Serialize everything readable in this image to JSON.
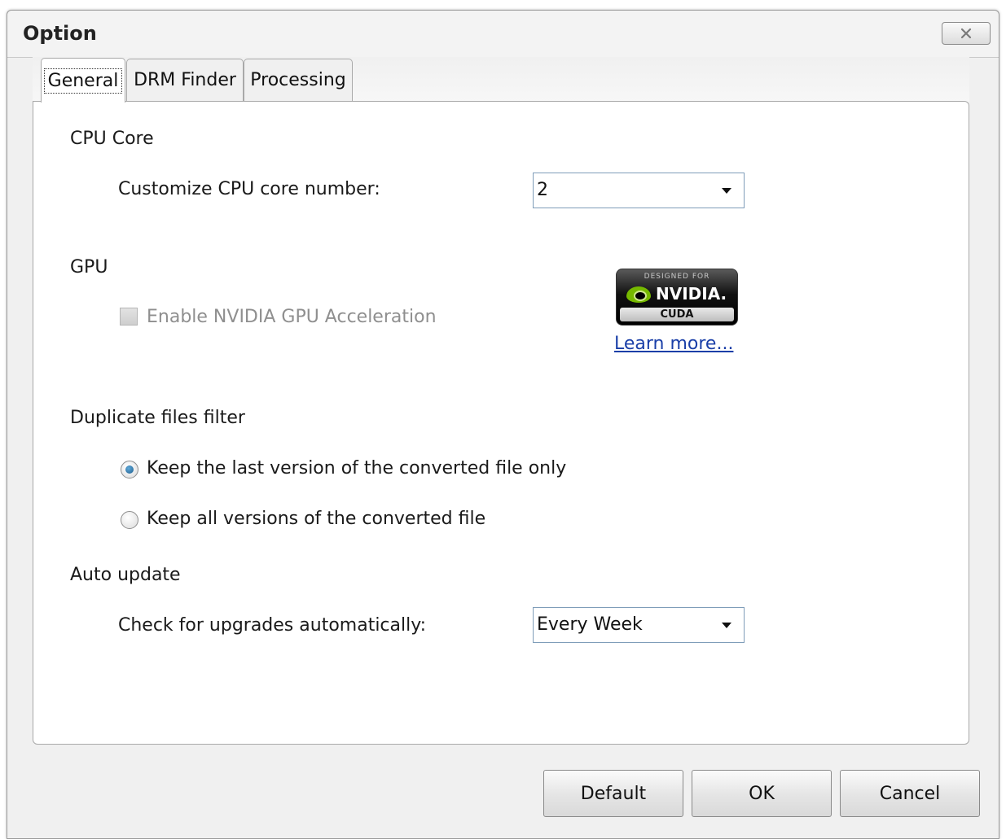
{
  "window": {
    "title": "Option",
    "close_icon": "close-x-icon"
  },
  "tabs": [
    {
      "label": "General",
      "active": true
    },
    {
      "label": "DRM Finder",
      "active": false
    },
    {
      "label": "Processing",
      "active": false
    }
  ],
  "general": {
    "cpu": {
      "heading": "CPU Core",
      "label": "Customize CPU core number:",
      "value": "2"
    },
    "gpu": {
      "heading": "GPU",
      "checkbox_label": "Enable NVIDIA GPU Acceleration",
      "checked": false,
      "enabled": false,
      "badge": {
        "top": "DESIGNED FOR",
        "brand": "NVIDIA.",
        "bottom": "CUDA"
      },
      "learn_more": "Learn more..."
    },
    "duplicate": {
      "heading": "Duplicate files filter",
      "options": [
        {
          "label": "Keep the last version of the converted file only",
          "selected": true
        },
        {
          "label": "Keep all versions of the converted file",
          "selected": false
        }
      ]
    },
    "update": {
      "heading": "Auto update",
      "label": "Check for upgrades automatically:",
      "value": "Every Week"
    }
  },
  "buttons": {
    "default": "Default",
    "ok": "OK",
    "cancel": "Cancel"
  }
}
